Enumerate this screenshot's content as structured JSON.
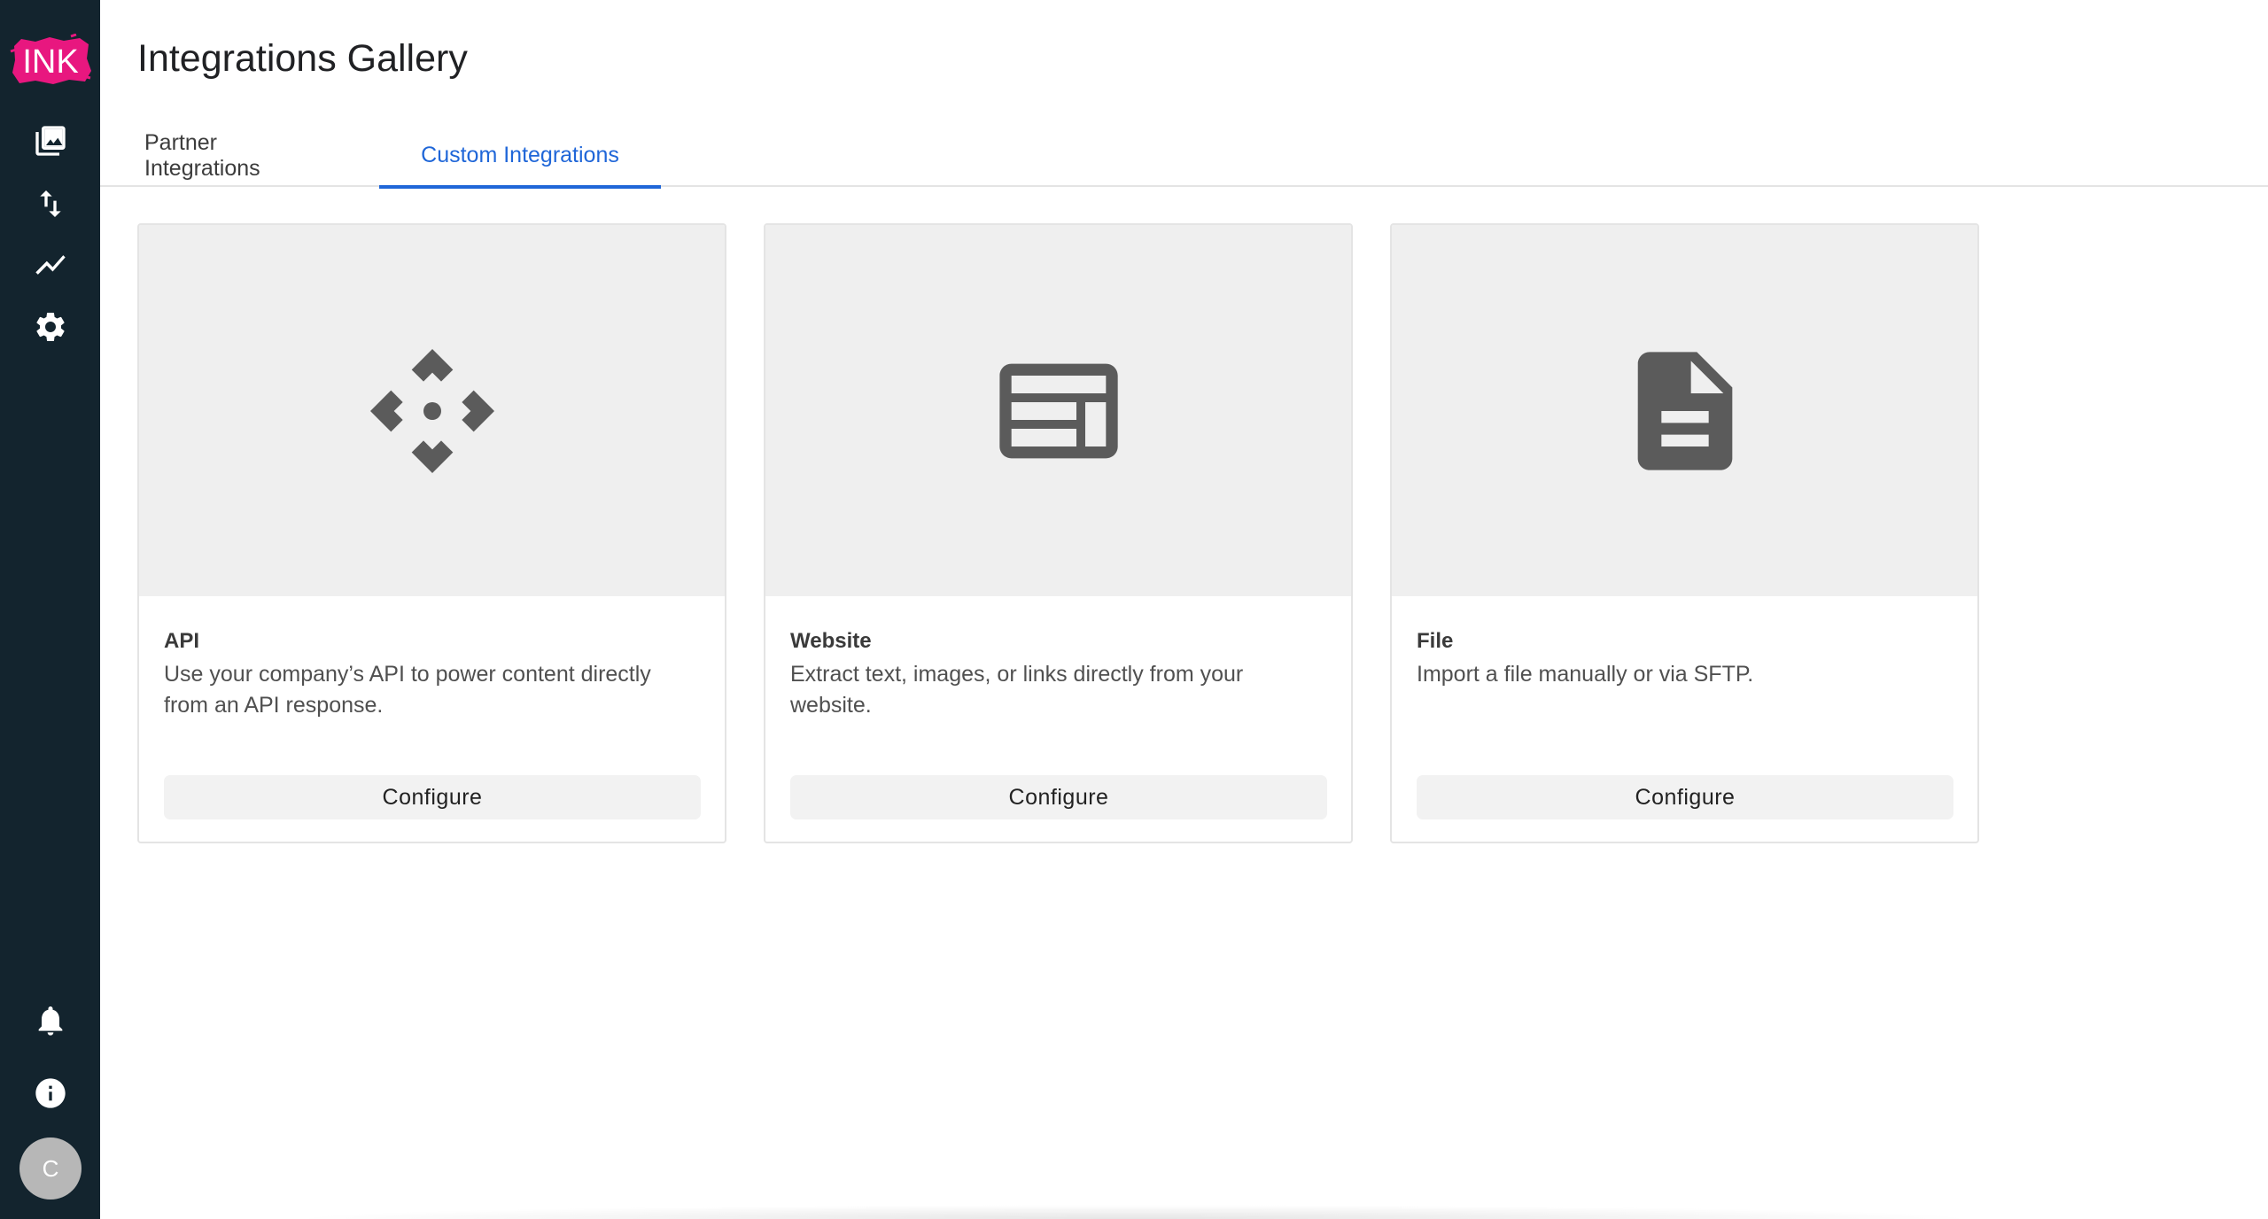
{
  "app": {
    "logo_text": "INK"
  },
  "sidebar": {
    "top_items": [
      {
        "icon": "image-gallery-icon"
      },
      {
        "icon": "arrows-up-down-icon"
      },
      {
        "icon": "trending-line-icon"
      },
      {
        "icon": "gear-icon"
      }
    ],
    "bottom_items": [
      {
        "icon": "bell-icon"
      },
      {
        "icon": "info-icon"
      }
    ],
    "avatar_initial": "C"
  },
  "header": {
    "title": "Integrations Gallery"
  },
  "tabs": [
    {
      "label": "Partner Integrations",
      "active": false
    },
    {
      "label": "Custom Integrations",
      "active": true
    }
  ],
  "cards": [
    {
      "title": "API",
      "description": "Use your company’s API to power content directly from an API response.",
      "button": "Configure",
      "icon": "api-icon"
    },
    {
      "title": "Website",
      "description": "Extract text, images, or links directly from your website.",
      "button": "Configure",
      "icon": "web-layout-icon"
    },
    {
      "title": "File",
      "description": "Import a file manually or via SFTP.",
      "button": "Configure",
      "icon": "file-icon"
    }
  ],
  "colors": {
    "sidebar_bg": "#13242e",
    "accent": "#1f66d8",
    "logo_pink": "#e8177f"
  }
}
